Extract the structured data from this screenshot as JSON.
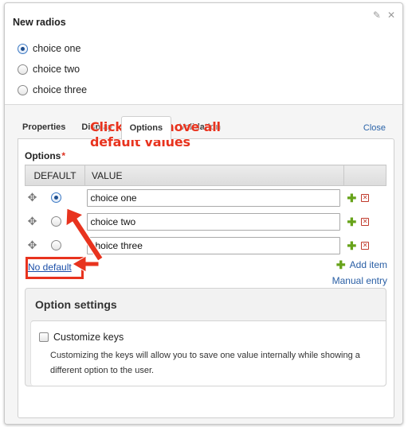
{
  "panel": {
    "field_title": "New radios",
    "edit_icon": "pencil-icon",
    "close_icon": "close-icon"
  },
  "preview": {
    "options": [
      {
        "label": "choice one",
        "checked": true
      },
      {
        "label": "choice two",
        "checked": false
      },
      {
        "label": "choice three",
        "checked": false
      }
    ]
  },
  "tabs": {
    "items": [
      "Properties",
      "Display",
      "Options",
      "Validation"
    ],
    "active": "Options",
    "close_label": "Close"
  },
  "options_tab": {
    "label": "Options",
    "required_marker": "*",
    "col_default": "DEFAULT",
    "col_value": "VALUE",
    "rows": [
      {
        "value": "choice one",
        "default": true
      },
      {
        "value": "choice two",
        "default": false
      },
      {
        "value": "choice three",
        "default": false
      }
    ],
    "no_default_label": "No default",
    "add_item_label": "Add item",
    "manual_entry_label": "Manual entry"
  },
  "annotation": {
    "line1": "Click to remove all",
    "line2": "default values",
    "color": "#e8331e"
  },
  "option_settings": {
    "title": "Option settings",
    "checkbox_label": "Customize keys",
    "description": "Customizing the keys will allow you to save one value internally while showing a different option to the user."
  }
}
